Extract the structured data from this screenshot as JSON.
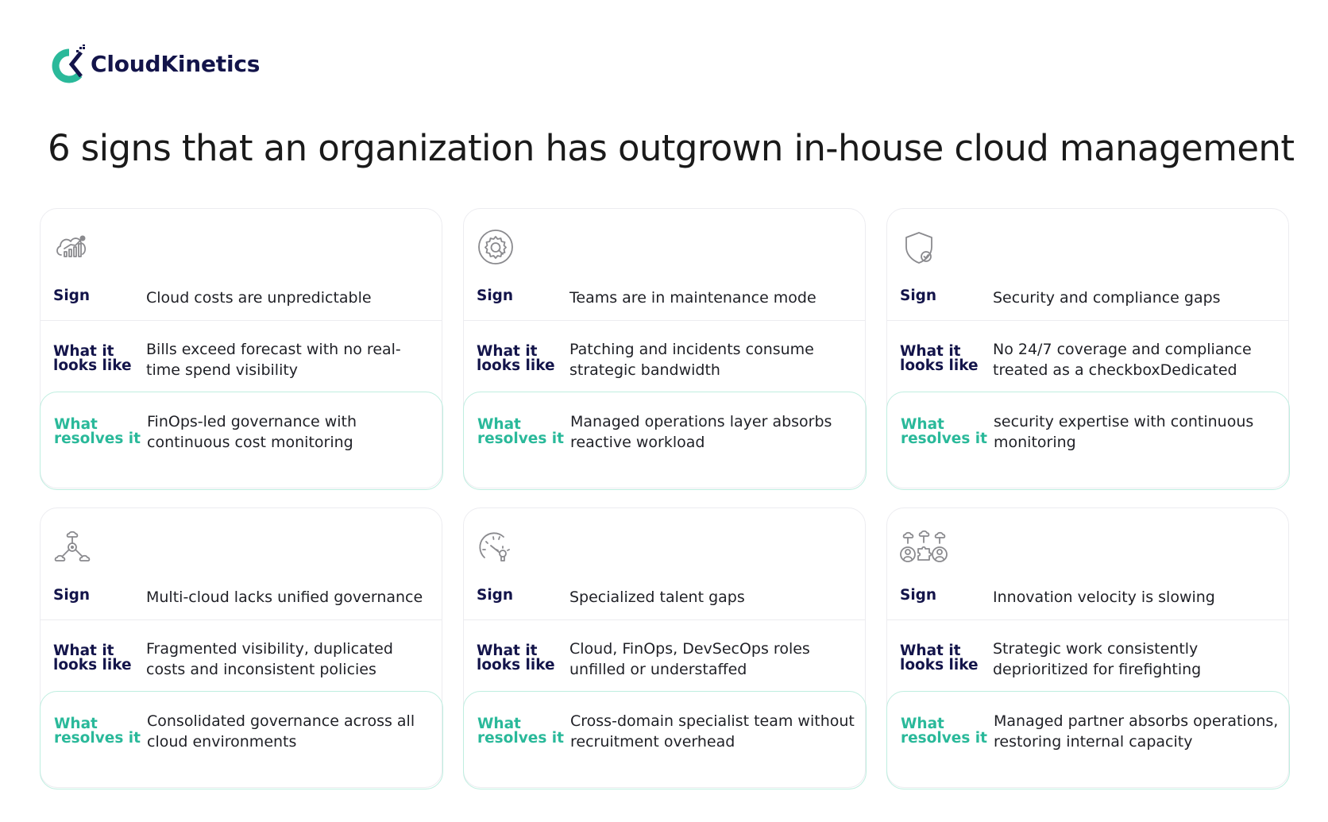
{
  "brand": {
    "name": "CloudKinetics",
    "primary_color": "#13144a",
    "accent_color": "#2ab99a"
  },
  "title": "6 signs that an organization has outgrown in-house cloud management",
  "labels": {
    "sign": "Sign",
    "looks_1": "What it",
    "looks_2": "looks like",
    "resolves_1": "What",
    "resolves_2": "resolves it"
  },
  "cards": [
    {
      "icon": "cloud-cost-chart-icon",
      "sign": "Cloud costs are unpredictable",
      "looks_like": "Bills exceed forecast with no real-time spend visibility",
      "resolves": "FinOps-led governance with continuous cost monitoring"
    },
    {
      "icon": "gear-maintenance-icon",
      "sign": "Teams are in maintenance mode",
      "looks_like": "Patching and incidents consume strategic bandwidth",
      "resolves": "Managed operations layer absorbs reactive workload"
    },
    {
      "icon": "shield-check-icon",
      "sign": "Security and compliance gaps",
      "looks_like": "No 24/7 coverage and compliance treated as a checkboxDedicated",
      "resolves": "security expertise with continuous monitoring"
    },
    {
      "icon": "multi-cloud-network-icon",
      "sign": "Multi-cloud lacks unified governance",
      "looks_like": "Fragmented visibility, duplicated costs and inconsistent policies",
      "resolves": "Consolidated governance across all cloud environments"
    },
    {
      "icon": "speedometer-talent-icon",
      "sign": "Specialized talent gaps",
      "looks_like": "Cloud, FinOps, DevSecOps roles unfilled or understaffed",
      "resolves": "Cross-domain specialist team without recruitment overhead"
    },
    {
      "icon": "team-cloud-puzzle-icon",
      "sign": "Innovation velocity is slowing",
      "looks_like": "Strategic work consistently deprioritized for firefighting",
      "resolves": "Managed partner absorbs operations, restoring internal capacity"
    }
  ]
}
